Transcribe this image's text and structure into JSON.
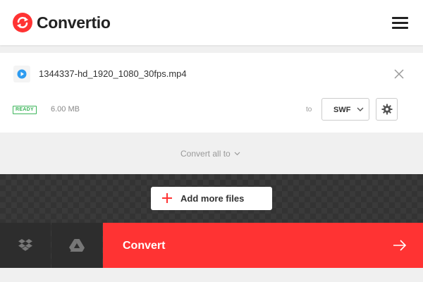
{
  "header": {
    "brand": "Convertio",
    "logo_icon": "convertio-logo-icon",
    "menu_icon": "hamburger-menu-icon"
  },
  "file": {
    "icon": "video-play-icon",
    "name": "1344337-hd_1920_1080_30fps.mp4",
    "status": "READY",
    "size": "6.00 MB",
    "to_label": "to",
    "format": "SWF",
    "remove_icon": "close-icon",
    "settings_icon": "gear-icon"
  },
  "convert_all": {
    "label": "Convert all to"
  },
  "upload": {
    "add_more_label": "Add more files",
    "dropbox_icon": "dropbox-icon",
    "gdrive_icon": "google-drive-icon",
    "convert_label": "Convert"
  },
  "colors": {
    "brand_red": "#ff3333",
    "ready_green": "#3cb55a",
    "dark_panel": "#2d2d2d"
  }
}
